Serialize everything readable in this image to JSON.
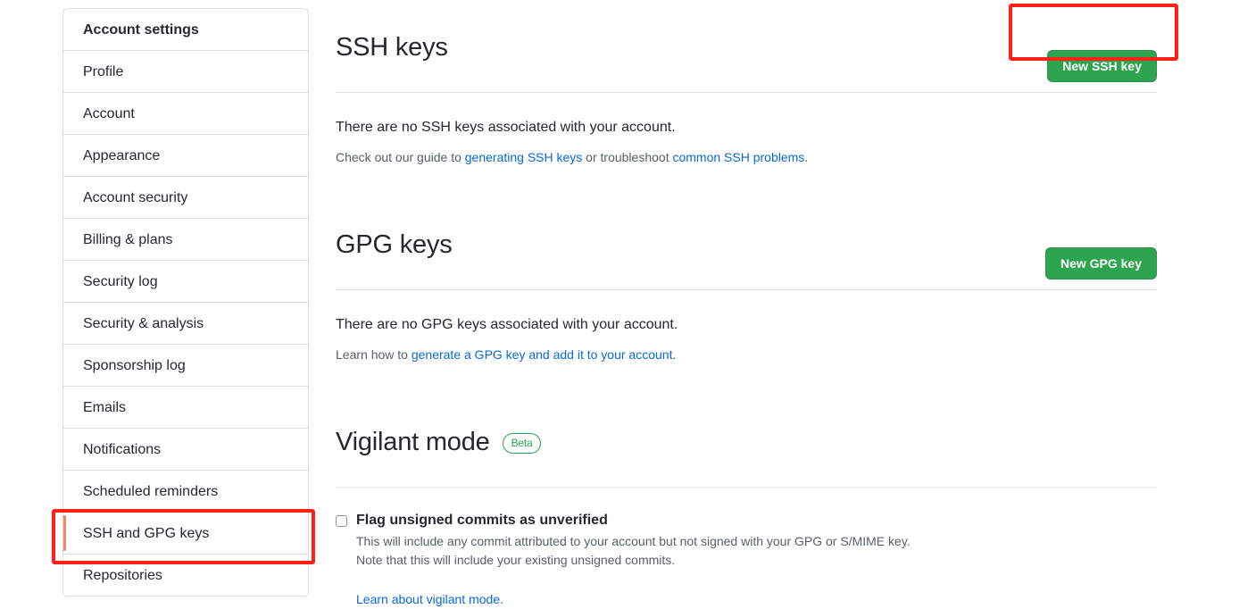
{
  "sidebar": {
    "header": "Account settings",
    "items": [
      {
        "label": "Profile",
        "active": false
      },
      {
        "label": "Account",
        "active": false
      },
      {
        "label": "Appearance",
        "active": false
      },
      {
        "label": "Account security",
        "active": false
      },
      {
        "label": "Billing & plans",
        "active": false
      },
      {
        "label": "Security log",
        "active": false
      },
      {
        "label": "Security & analysis",
        "active": false
      },
      {
        "label": "Sponsorship log",
        "active": false
      },
      {
        "label": "Emails",
        "active": false
      },
      {
        "label": "Notifications",
        "active": false
      },
      {
        "label": "Scheduled reminders",
        "active": false
      },
      {
        "label": "SSH and GPG keys",
        "active": true
      },
      {
        "label": "Repositories",
        "active": false
      }
    ]
  },
  "ssh_section": {
    "title": "SSH keys",
    "new_key_button": "New SSH key",
    "empty_message": "There are no SSH keys associated with your account.",
    "help_prefix": "Check out our guide to ",
    "help_link_1": "generating SSH keys",
    "help_middle": " or troubleshoot ",
    "help_link_2": "common SSH problems",
    "help_suffix": "."
  },
  "gpg_section": {
    "title": "GPG keys",
    "new_key_button": "New GPG key",
    "empty_message": "There are no GPG keys associated with your account.",
    "help_prefix": "Learn how to ",
    "help_link": "generate a GPG key and add it to your account",
    "help_suffix": "."
  },
  "vigilant_section": {
    "title": "Vigilant mode",
    "badge": "Beta",
    "checkbox_label": "Flag unsigned commits as unverified",
    "checkbox_checked": false,
    "description_line_1": "This will include any commit attributed to your account but not signed with your GPG or S/MIME key.",
    "description_line_2": "Note that this will include your existing unsigned commits.",
    "learn_link": "Learn about vigilant mode."
  },
  "annotations": {
    "color": "#ff2116",
    "highlighted_elements": [
      "New SSH key",
      "SSH and GPG keys"
    ]
  }
}
